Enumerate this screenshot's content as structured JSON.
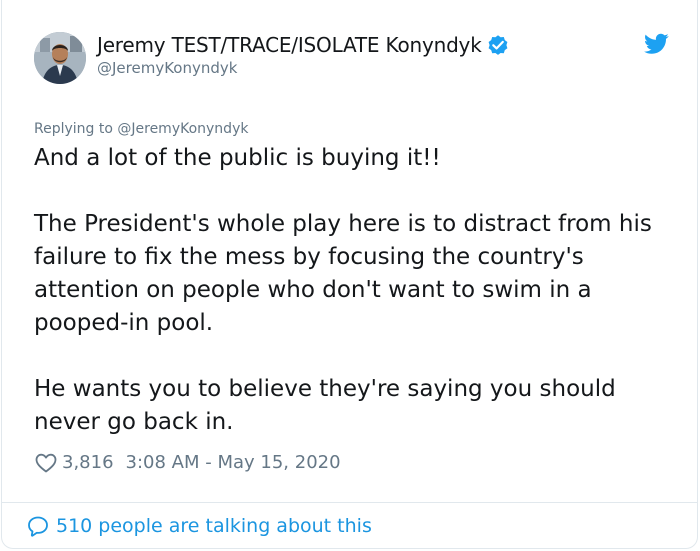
{
  "author": {
    "display_name": "Jeremy TEST/TRACE/ISOLATE Konyndyk",
    "handle": "@JeremyKonyndyk",
    "verified": true,
    "avatar_icon": "profile-photo"
  },
  "tweet": {
    "replying_to": "Replying to @JeremyKonyndyk",
    "paragraphs": [
      "And a lot of the public is buying it!!",
      "The President's whole play here is to distract from his failure to fix the mess by focusing the country's attention on people who don't want to swim in a pooped-in pool.",
      "He wants you to believe they're saying you should never go back in."
    ],
    "likes": "3,816",
    "timestamp": "3:08 AM - May 15, 2020"
  },
  "footer": {
    "talking": "510 people are talking about this"
  },
  "icons": {
    "brand": "twitter-bird-icon",
    "like": "heart-icon",
    "reply": "speech-bubble-icon",
    "verified": "verified-badge-icon"
  },
  "colors": {
    "twitter_blue": "#1da1f2",
    "link_blue": "#1b95e0",
    "muted_text": "#657786",
    "main_text": "#14171a",
    "border": "#e1e8ed"
  }
}
